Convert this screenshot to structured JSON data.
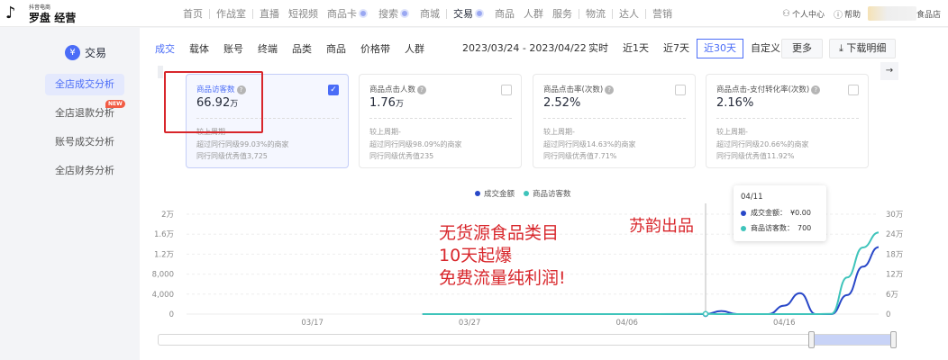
{
  "brand": {
    "small_text": "抖音电商",
    "name_part1": "罗盘",
    "name_part2": "经营",
    "mark": "♪"
  },
  "topnav": {
    "items": [
      {
        "label": "首页",
        "dot": false,
        "active": false
      },
      {
        "label": "作战室",
        "dot": false,
        "active": false
      },
      {
        "label": "直播",
        "dot": false,
        "active": false
      },
      {
        "label": "短视频",
        "dot": false,
        "active": false
      },
      {
        "label": "商品卡",
        "dot": true,
        "active": false
      },
      {
        "label": "搜索",
        "dot": true,
        "active": false
      },
      {
        "label": "商城",
        "dot": false,
        "active": false
      },
      {
        "label": "交易",
        "dot": true,
        "active": true
      },
      {
        "label": "商品",
        "dot": false,
        "active": false
      },
      {
        "label": "人群",
        "dot": false,
        "active": false
      },
      {
        "label": "服务",
        "dot": false,
        "active": false
      },
      {
        "label": "物流",
        "dot": false,
        "active": false
      },
      {
        "label": "达人",
        "dot": false,
        "active": false
      },
      {
        "label": "营销",
        "dot": false,
        "active": false
      }
    ],
    "personal_center": "个人中心",
    "help": "帮助",
    "store_name": "食品店"
  },
  "sidebar": {
    "section_title": "交易",
    "section_icon": "¥",
    "items": [
      {
        "label": "全店成交分析",
        "active": true,
        "badge": ""
      },
      {
        "label": "全店退款分析",
        "active": false,
        "badge": "NEW"
      },
      {
        "label": "账号成交分析",
        "active": false,
        "badge": ""
      },
      {
        "label": "全店财务分析",
        "active": false,
        "badge": ""
      }
    ]
  },
  "filters": {
    "carriers": [
      "成交",
      "载体",
      "账号",
      "终端",
      "品类",
      "商品",
      "价格带",
      "人群"
    ],
    "date_range": "2023/03/24 - 2023/04/22",
    "ranges": [
      {
        "label": "实时",
        "active": false
      },
      {
        "label": "近1天",
        "active": false
      },
      {
        "label": "近7天",
        "active": false
      },
      {
        "label": "近30天",
        "active": true
      },
      {
        "label": "自定义",
        "active": false
      }
    ],
    "more": "更多",
    "download": "下载明细",
    "download_icon": "⤓",
    "next_arrow": "→"
  },
  "cards": [
    {
      "title": "商品访客数",
      "value": "66.92",
      "unit": "万",
      "selected": true,
      "compare": "较上周期-",
      "line1": "超过同行同级99.03%的商家",
      "line2": "同行同级优秀值3,725"
    },
    {
      "title": "商品点击人数",
      "value": "1.76",
      "unit": "万",
      "selected": false,
      "compare": "较上周期-",
      "line1": "超过同行同级98.09%的商家",
      "line2": "同行同级优秀值235"
    },
    {
      "title": "商品点击率(次数)",
      "value": "2.52%",
      "unit": "",
      "selected": false,
      "compare": "较上周期-",
      "line1": "超过同行同级14.63%的商家",
      "line2": "同行同级优秀值7.71%"
    },
    {
      "title": "商品点击-支付转化率(次数)",
      "value": "2.16%",
      "unit": "",
      "selected": false,
      "compare": "较上周期-",
      "line1": "超过同行同级20.66%的商家",
      "line2": "同行同级优秀值11.92%"
    }
  ],
  "chart_data": {
    "type": "line",
    "x_ticks": [
      "03/17",
      "03/27",
      "04/06",
      "04/16"
    ],
    "y_left_ticks": [
      "0",
      "4,000",
      "8,000",
      "1.2万",
      "1.6万",
      "2万"
    ],
    "y_right_ticks": [
      "0",
      "6万",
      "12万",
      "18万",
      "24万",
      "30万"
    ],
    "ylim_left": [
      0,
      20000
    ],
    "ylim_right": [
      0,
      300000
    ],
    "legend_position": "top-center",
    "series": [
      {
        "name": "成交金额",
        "color": "#2847c8",
        "axis": "left",
        "points": [
          [
            "03/24",
            0
          ],
          [
            "03/28",
            0
          ],
          [
            "04/03",
            0
          ],
          [
            "04/08",
            0
          ],
          [
            "04/11",
            0
          ],
          [
            "04/12",
            600
          ],
          [
            "04/13",
            0
          ],
          [
            "04/14",
            0
          ],
          [
            "04/15",
            0
          ],
          [
            "04/16",
            1700
          ],
          [
            "04/17",
            4200
          ],
          [
            "04/18",
            0
          ],
          [
            "04/19",
            0
          ],
          [
            "04/20",
            3800
          ],
          [
            "04/21",
            9500
          ],
          [
            "04/22",
            13400
          ]
        ]
      },
      {
        "name": "商品访客数",
        "color": "#3fc4bb",
        "axis": "right",
        "points": [
          [
            "03/24",
            0
          ],
          [
            "03/28",
            0
          ],
          [
            "04/03",
            0
          ],
          [
            "04/08",
            0
          ],
          [
            "04/11",
            700
          ],
          [
            "04/12",
            0
          ],
          [
            "04/13",
            0
          ],
          [
            "04/14",
            0
          ],
          [
            "04/15",
            0
          ],
          [
            "04/16",
            0
          ],
          [
            "04/17",
            0
          ],
          [
            "04/18",
            0
          ],
          [
            "04/19",
            800
          ],
          [
            "04/20",
            110000
          ],
          [
            "04/21",
            200000
          ],
          [
            "04/22",
            245000
          ]
        ]
      }
    ],
    "tooltip": {
      "date": "04/11",
      "rows": [
        {
          "name": "成交金额",
          "sep": "：",
          "value": "¥0.00"
        },
        {
          "name": "商品访客数",
          "sep": "：",
          "value": "700"
        }
      ]
    }
  },
  "overlay_text": {
    "line1": "无货源食品类目",
    "line2": "10天起爆",
    "line3": "免费流量纯利润!",
    "side": "苏韵出品"
  }
}
